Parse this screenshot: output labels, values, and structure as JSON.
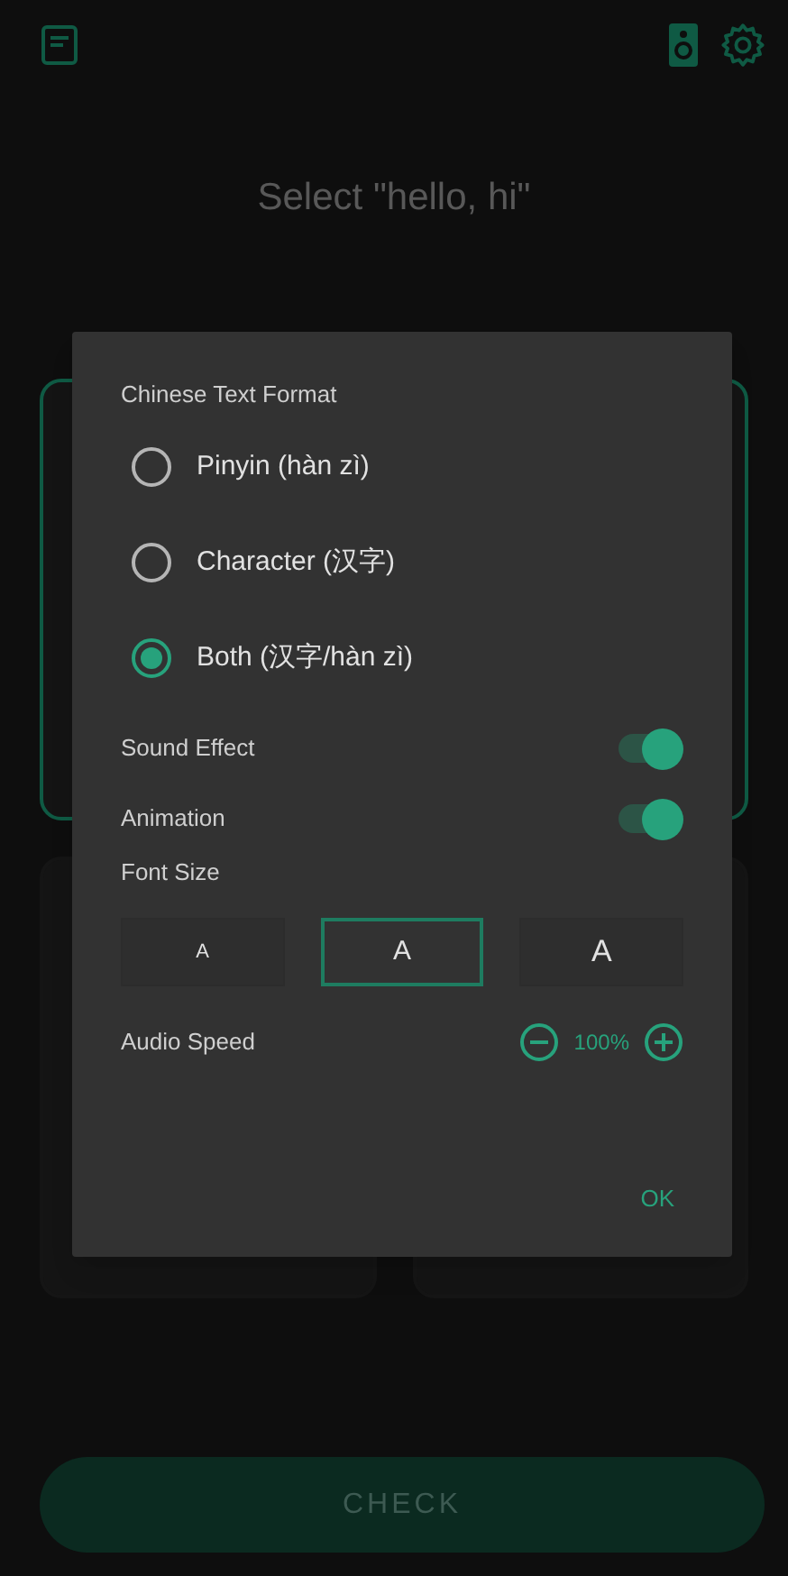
{
  "prompt": "Select \"hello, hi\"",
  "options": [
    {
      "selected": true
    },
    {
      "selected": false
    },
    {
      "selected": false
    }
  ],
  "check_button": "CHECK",
  "dialog": {
    "section_title": "Chinese Text Format",
    "formats": [
      {
        "label": "Pinyin (hàn zì)",
        "selected": false
      },
      {
        "label": "Character (汉字)",
        "selected": false
      },
      {
        "label": "Both (汉字/hàn zì)",
        "selected": true
      }
    ],
    "toggles": [
      {
        "label": "Sound Effect",
        "on": true
      },
      {
        "label": "Animation",
        "on": true
      }
    ],
    "font_size_label": "Font Size",
    "font_sizes": [
      {
        "label": "A",
        "selected": false
      },
      {
        "label": "A",
        "selected": true
      },
      {
        "label": "A",
        "selected": false
      }
    ],
    "audio_speed_label": "Audio Speed",
    "audio_speed": "100%",
    "ok": "OK"
  }
}
